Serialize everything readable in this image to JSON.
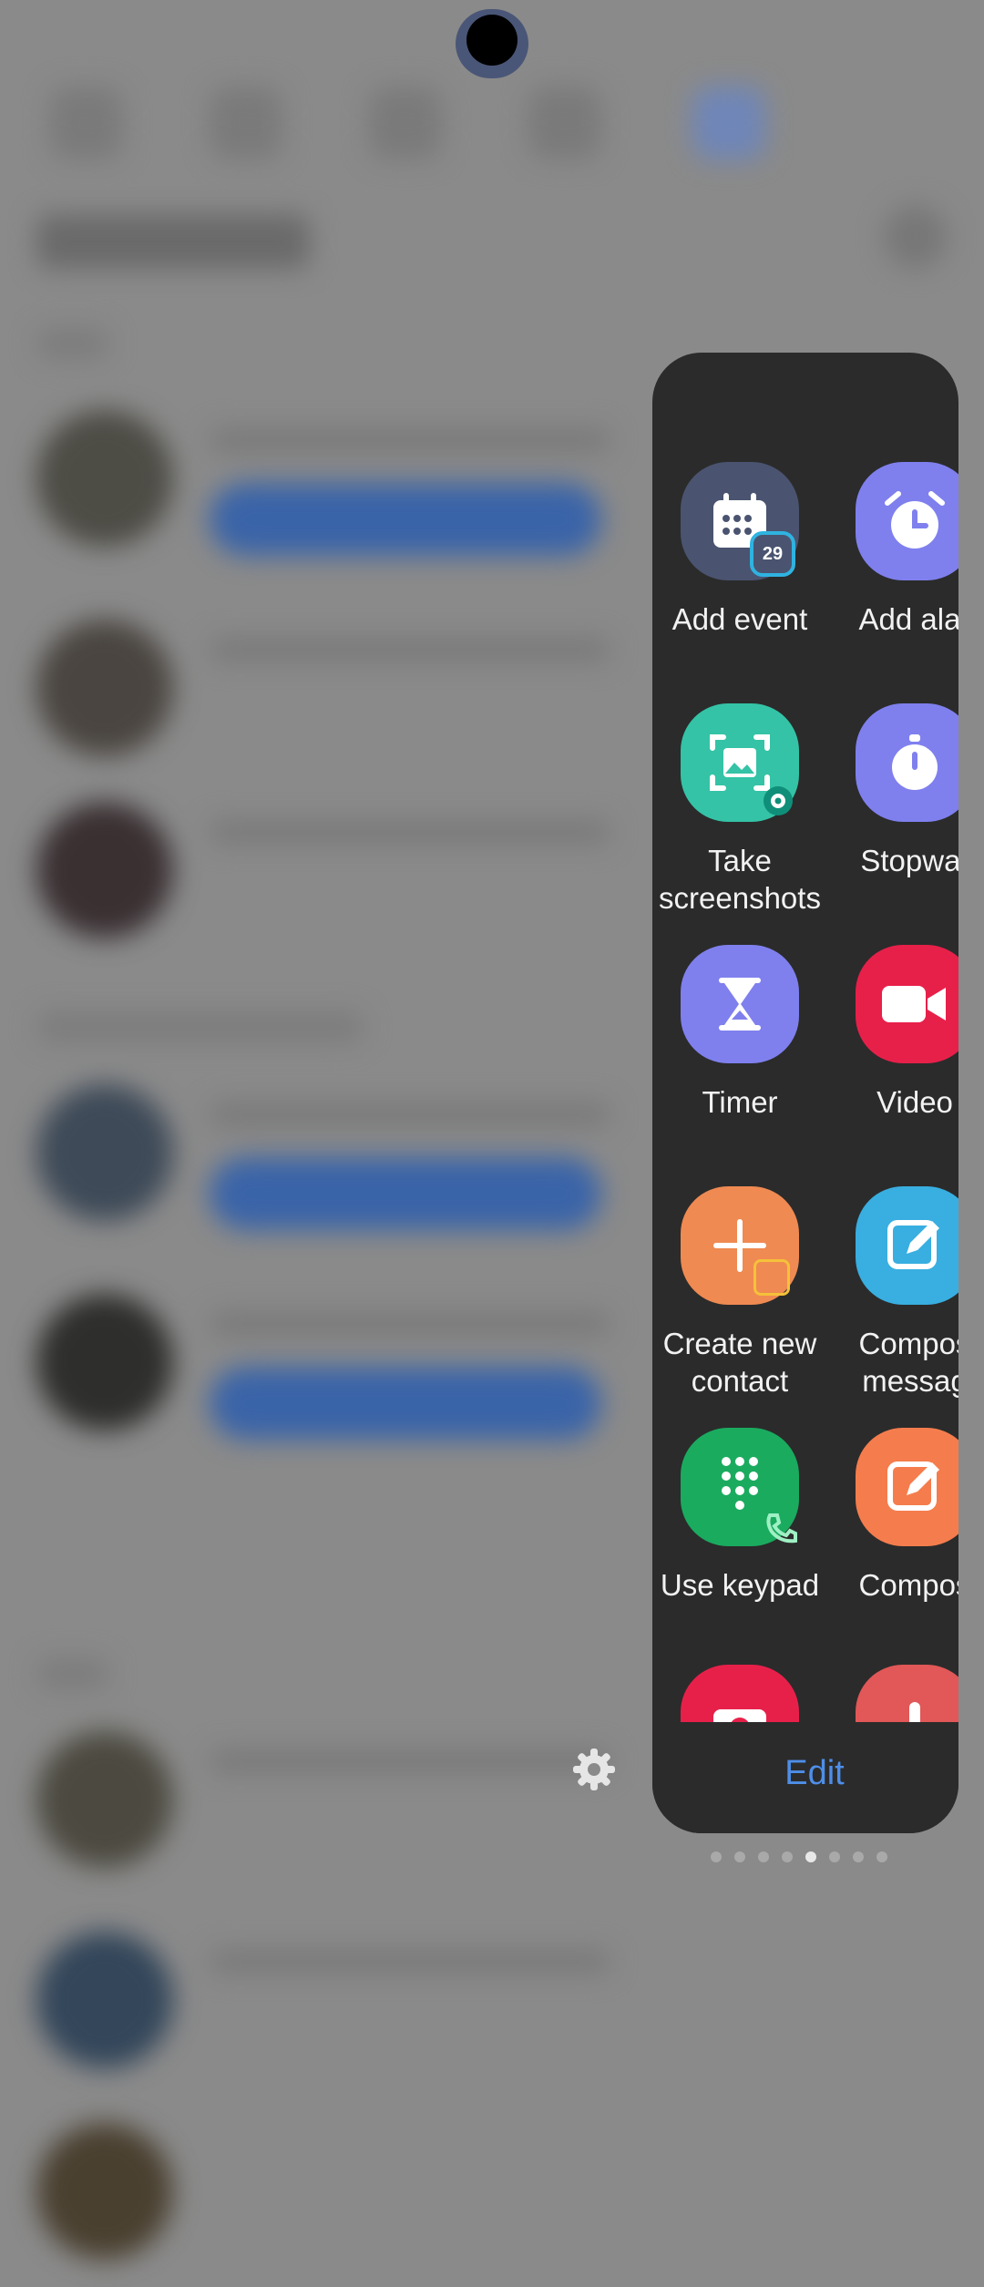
{
  "edge_panel": {
    "tiles": [
      {
        "label": "Add event",
        "icon": "calendar-icon",
        "color": "#4a5470",
        "badge_text": "29",
        "badge_color": "#2fb3e0"
      },
      {
        "label": "Add alar",
        "icon": "alarm-icon",
        "color": "#7f80ee"
      },
      {
        "label": "Take\nscreenshots",
        "icon": "screenshot-icon",
        "color": "#34c3a6"
      },
      {
        "label": "Stopwat",
        "icon": "stopwatch-icon",
        "color": "#7f80ee"
      },
      {
        "label": "Timer",
        "icon": "hourglass-icon",
        "color": "#7f80ee"
      },
      {
        "label": "Video",
        "icon": "video-camera-icon",
        "color": "#e7204a"
      },
      {
        "label": "Create new\ncontact",
        "icon": "plus-icon",
        "color": "#ef8a52"
      },
      {
        "label": "Compos\nmessag",
        "icon": "compose-message-icon",
        "color": "#39aee0"
      },
      {
        "label": "Use keypad",
        "icon": "keypad-icon",
        "color": "#1aab5f"
      },
      {
        "label": "Compos",
        "icon": "compose-email-icon",
        "color": "#f57d4d"
      },
      {
        "label": "",
        "icon": "camera-icon",
        "color": "#e7204a"
      },
      {
        "label": "",
        "icon": "voice-recorder-icon",
        "color": "#e25757"
      }
    ],
    "edit_label": "Edit",
    "page_count": 8,
    "active_page": 5,
    "accent_color": "#4e8ee8"
  }
}
